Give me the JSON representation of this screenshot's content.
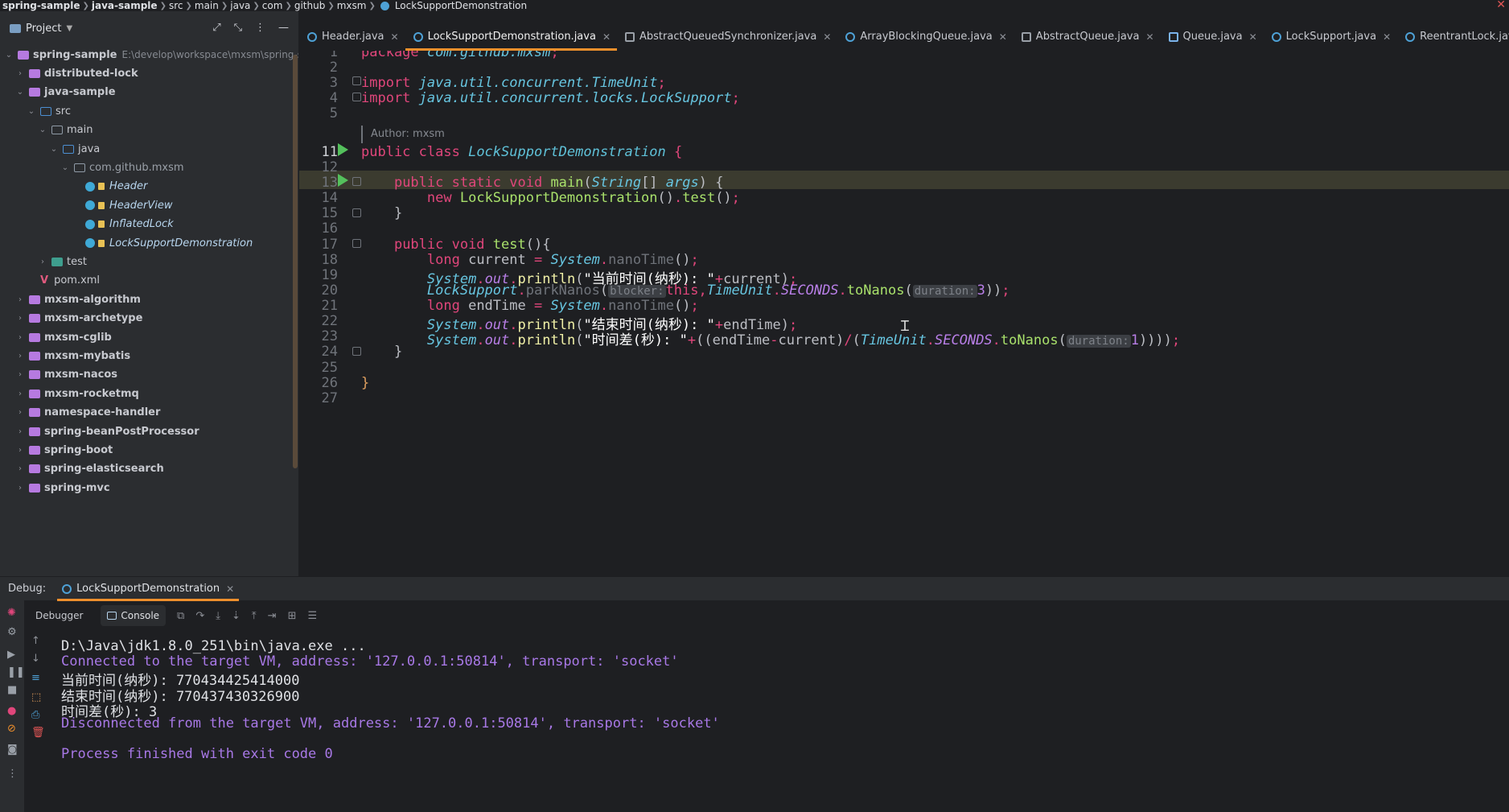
{
  "breadcrumb": {
    "items": [
      "spring-sample",
      "java-sample",
      "src",
      "main",
      "java",
      "com",
      "github",
      "mxsm",
      "LockSupportDemonstration"
    ]
  },
  "project_panel": {
    "title": "Project",
    "tree": [
      {
        "label": "spring-sample",
        "path": "E:\\develop\\workspace\\mxsm\\spring-sam",
        "kind": "module",
        "expanded": true
      },
      {
        "label": "distributed-lock",
        "kind": "module",
        "expanded": false
      },
      {
        "label": "java-sample",
        "kind": "module",
        "expanded": true
      },
      {
        "label": "src",
        "kind": "src",
        "expanded": true
      },
      {
        "label": "main",
        "kind": "plain",
        "expanded": true
      },
      {
        "label": "java",
        "kind": "src",
        "expanded": true
      },
      {
        "label": "com.github.mxsm",
        "kind": "plain",
        "expanded": true
      },
      {
        "label": "Header",
        "kind": "class"
      },
      {
        "label": "HeaderView",
        "kind": "class"
      },
      {
        "label": "InflatedLock",
        "kind": "class"
      },
      {
        "label": "LockSupportDemonstration",
        "kind": "class"
      },
      {
        "label": "test",
        "kind": "test",
        "expanded": false
      },
      {
        "label": "pom.xml",
        "kind": "maven"
      },
      {
        "label": "mxsm-algorithm",
        "kind": "module",
        "expanded": false
      },
      {
        "label": "mxsm-archetype",
        "kind": "module",
        "expanded": false
      },
      {
        "label": "mxsm-cglib",
        "kind": "module",
        "expanded": false
      },
      {
        "label": "mxsm-mybatis",
        "kind": "module",
        "expanded": false
      },
      {
        "label": "mxsm-nacos",
        "kind": "module",
        "expanded": false
      },
      {
        "label": "mxsm-rocketmq",
        "kind": "module",
        "expanded": false
      },
      {
        "label": "namespace-handler",
        "kind": "module",
        "expanded": false
      },
      {
        "label": "spring-beanPostProcessor",
        "kind": "module",
        "expanded": false
      },
      {
        "label": "spring-boot",
        "kind": "module",
        "expanded": false
      },
      {
        "label": "spring-elasticsearch",
        "kind": "module",
        "expanded": false
      },
      {
        "label": "spring-mvc",
        "kind": "module",
        "expanded": false
      }
    ]
  },
  "tabs": [
    {
      "label": "Header.java",
      "icon": "class-icon"
    },
    {
      "label": "LockSupportDemonstration.java",
      "icon": "class-icon",
      "active": true
    },
    {
      "label": "AbstractQueuedSynchronizer.java",
      "icon": "abstract-class-icon"
    },
    {
      "label": "ArrayBlockingQueue.java",
      "icon": "class-icon"
    },
    {
      "label": "AbstractQueue.java",
      "icon": "abstract-class-icon"
    },
    {
      "label": "Queue.java",
      "icon": "interface-icon"
    },
    {
      "label": "LockSupport.java",
      "icon": "class-icon"
    },
    {
      "label": "ReentrantLock.java",
      "icon": "class-icon"
    },
    {
      "label": "Condition.java",
      "icon": "interface-icon"
    }
  ],
  "editor": {
    "line_numbers": [
      "1",
      "2",
      "3",
      "4",
      "5",
      "11",
      "12",
      "13",
      "14",
      "15",
      "16",
      "17",
      "18",
      "19",
      "20",
      "21",
      "22",
      "23",
      "24",
      "25",
      "26",
      "27"
    ],
    "author_hint": "Author: mxsm",
    "hints": {
      "blocker": "blocker:",
      "duration": "duration:"
    },
    "strings": {
      "l19": "\"当前时间(纳秒): \"",
      "l22": "\"结束时间(纳秒): \"",
      "l23": "\"时间差(秒): \""
    }
  },
  "debug": {
    "label": "Debug:",
    "session_tab": "LockSupportDemonstration",
    "subtabs": [
      "Debugger",
      "Console"
    ],
    "console_lines": [
      {
        "text": "D:\\Java\\jdk1.8.0_251\\bin\\java.exe ...",
        "style": "white"
      },
      {
        "text": "Connected to the target VM, address: '127.0.0.1:50814', transport: 'socket'",
        "style": "purple"
      },
      {
        "text": "当前时间(纳秒): 770434425414000",
        "style": "white"
      },
      {
        "text": "结束时间(纳秒): 770437430326900",
        "style": "white"
      },
      {
        "text": "时间差(秒): 3",
        "style": "white"
      },
      {
        "text": "Disconnected from the target VM, address: '127.0.0.1:50814', transport: 'socket'",
        "style": "purple"
      },
      {
        "text": "",
        "style": "white"
      },
      {
        "text": "Process finished with exit code 0",
        "style": "purple"
      }
    ]
  },
  "colors": {
    "accent": "#ee8f2c",
    "run": "#54c05c",
    "keyword": "#e0467b",
    "console_purple": "#a878e6"
  }
}
